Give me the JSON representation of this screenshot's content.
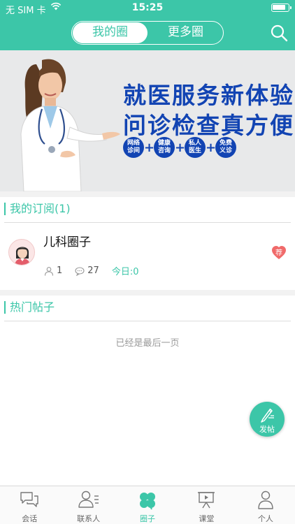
{
  "status_bar": {
    "carrier": "无 SIM 卡",
    "time": "15:25"
  },
  "header": {
    "segments": [
      "我的圈",
      "更多圈"
    ],
    "active_segment": "我的圈"
  },
  "banner": {
    "line1": "就医服务新体验",
    "line2": "问诊检查真方便",
    "badges": [
      {
        "top": "网络",
        "bottom": "诊间"
      },
      {
        "top": "健康",
        "bottom": "咨询"
      },
      {
        "top": "私人",
        "bottom": "医生"
      },
      {
        "top": "免费",
        "bottom": "义诊"
      }
    ],
    "plus": "+"
  },
  "subscriptions": {
    "title": "我的订阅(1)",
    "items": [
      {
        "name": "儿科圈子",
        "members": "1",
        "posts": "27",
        "today": "今日:0",
        "badge": "荐"
      }
    ]
  },
  "hot_posts": {
    "title": "热门帖子",
    "empty_text": "已经是最后一页"
  },
  "fab": {
    "label": "发帖"
  },
  "tabbar": {
    "items": [
      "会话",
      "联系人",
      "圈子",
      "课堂",
      "个人"
    ],
    "active": "圈子"
  },
  "colors": {
    "brand": "#3cc6a8",
    "banner_text": "#1244b3",
    "recommend": "#f06a6a"
  }
}
